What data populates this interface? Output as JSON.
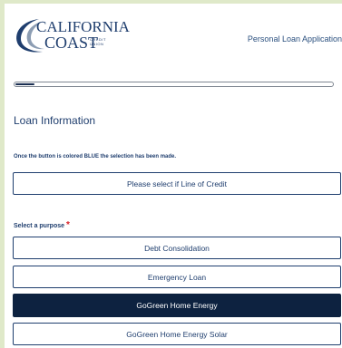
{
  "header": {
    "logo": {
      "line1": "CALIFORNIA",
      "line2": "COAST",
      "line3": "CREDIT UNION"
    },
    "app_title": "Personal Loan Application"
  },
  "progress": {
    "fraction": 0.06
  },
  "section": {
    "title": "Loan Information",
    "hint": "Once the button is colored BLUE the selection has been made."
  },
  "line_of_credit": {
    "label": "Please select if Line of Credit"
  },
  "purpose": {
    "label": "Select a purpose",
    "required_marker": "*",
    "options": [
      {
        "label": "Debt Consolidation",
        "selected": false
      },
      {
        "label": "Emergency Loan",
        "selected": false
      },
      {
        "label": "GoGreen Home Energy",
        "selected": true
      },
      {
        "label": "GoGreen Home Energy Solar",
        "selected": false
      }
    ]
  },
  "colors": {
    "brand_navy": "#1f3e6e",
    "selected_bg": "#0d2240",
    "required": "#d9252b",
    "page_border": "#dfe9c9"
  }
}
